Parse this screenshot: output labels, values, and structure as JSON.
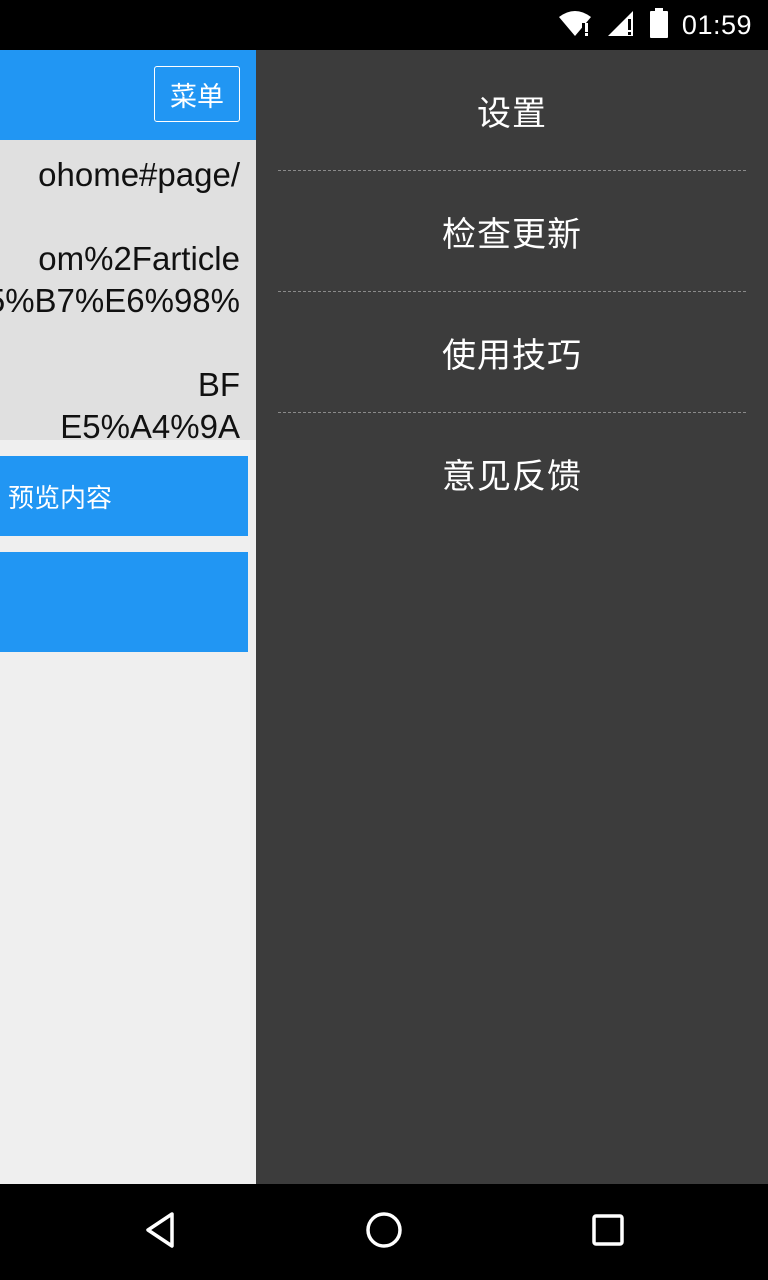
{
  "status_bar": {
    "time": "01:59",
    "icons": [
      "wifi-icon",
      "signal-icon",
      "battery-icon"
    ]
  },
  "app_bar": {
    "menu_label": "菜单"
  },
  "url_area": {
    "text": "ohome#page/\n\nom%2Farticle\n5%B7%E6%98%\n\nBF\nE5%A4%9A"
  },
  "buttons": {
    "preview_label": "预览内容"
  },
  "drawer": {
    "items": [
      {
        "label": "设置"
      },
      {
        "label": "检查更新"
      },
      {
        "label": "使用技巧"
      },
      {
        "label": "意见反馈"
      }
    ]
  },
  "nav_bar": {
    "icons": [
      "back-icon",
      "home-icon",
      "recents-icon"
    ]
  },
  "colors": {
    "accent": "#2196f3",
    "drawer_bg": "#3c3c3c",
    "main_bg": "#efefef",
    "url_bg": "#e0e0e0"
  }
}
